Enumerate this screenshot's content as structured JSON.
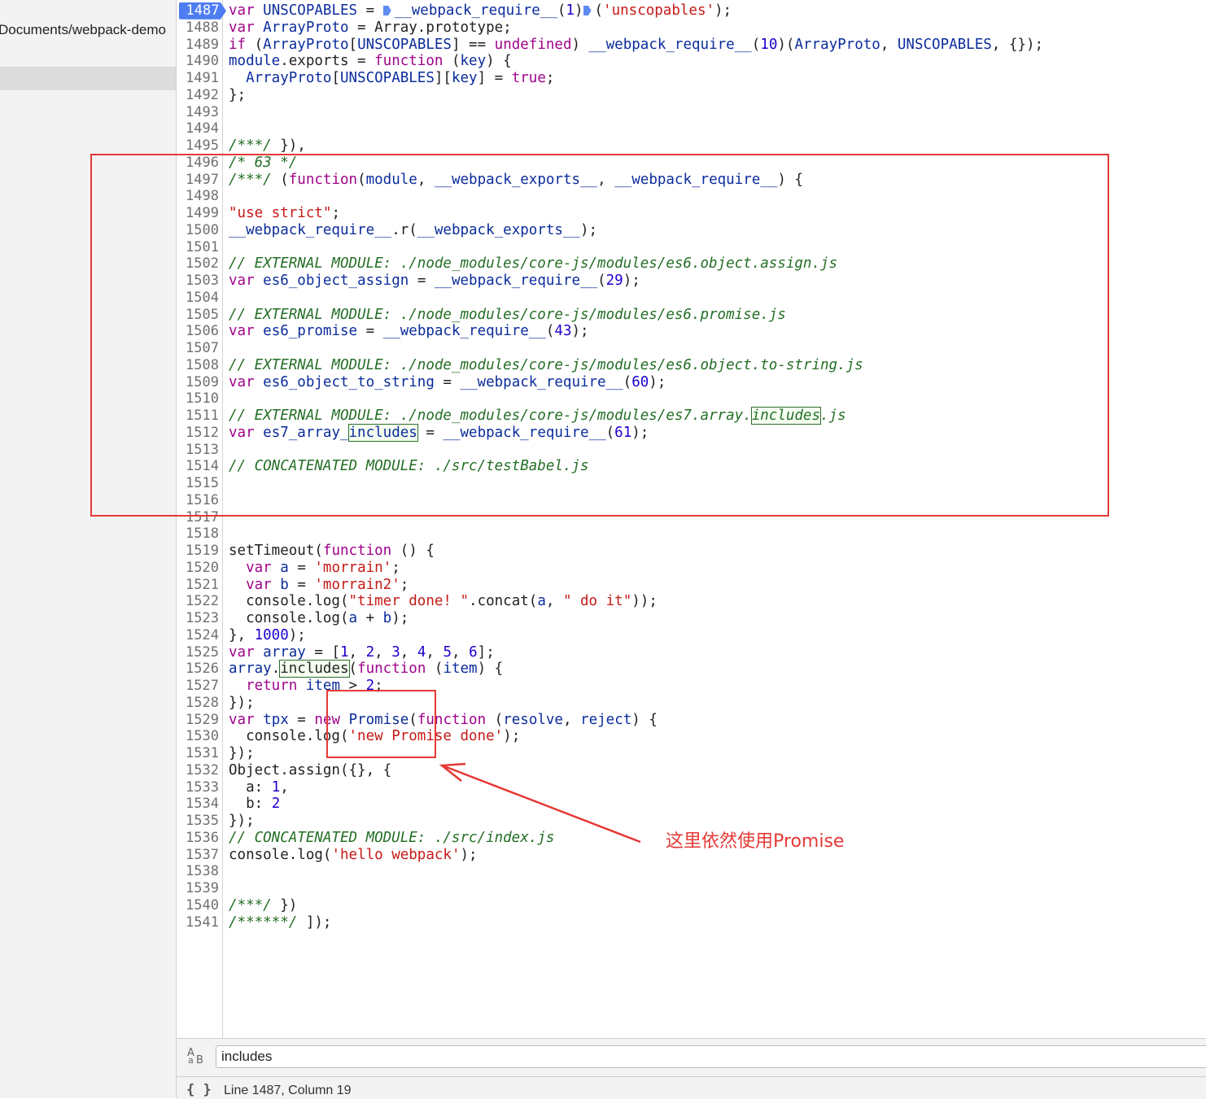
{
  "navigator": {
    "path_text": "Documents/webpack-demo"
  },
  "editor": {
    "active_line": "1487",
    "lines": [
      {
        "n": "1487",
        "segs": [
          {
            "t": "var ",
            "c": "kw2"
          },
          {
            "t": "UNSCOPABLES",
            "c": "var"
          },
          {
            "t": " = "
          },
          {
            "t": "",
            "c": "bp"
          },
          {
            "t": "__webpack_require__",
            "c": "var"
          },
          {
            "t": "("
          },
          {
            "t": "1",
            "c": "num"
          },
          {
            "t": ")"
          },
          {
            "t": "",
            "c": "bp"
          },
          {
            "t": "("
          },
          {
            "t": "'unscopables'",
            "c": "str"
          },
          {
            "t": ");"
          }
        ]
      },
      {
        "n": "1488",
        "segs": [
          {
            "t": "var ",
            "c": "kw2"
          },
          {
            "t": "ArrayProto",
            "c": "var"
          },
          {
            "t": " = Array.prototype;"
          }
        ]
      },
      {
        "n": "1489",
        "segs": [
          {
            "t": "if ",
            "c": "kw2"
          },
          {
            "t": "("
          },
          {
            "t": "ArrayProto",
            "c": "var"
          },
          {
            "t": "["
          },
          {
            "t": "UNSCOPABLES",
            "c": "var"
          },
          {
            "t": "] == "
          },
          {
            "t": "undefined",
            "c": "kw2"
          },
          {
            "t": ") "
          },
          {
            "t": "__webpack_require__",
            "c": "var"
          },
          {
            "t": "("
          },
          {
            "t": "10",
            "c": "num"
          },
          {
            "t": ")("
          },
          {
            "t": "ArrayProto",
            "c": "var"
          },
          {
            "t": ", "
          },
          {
            "t": "UNSCOPABLES",
            "c": "var"
          },
          {
            "t": ", {});"
          }
        ]
      },
      {
        "n": "1490",
        "segs": [
          {
            "t": "module",
            "c": "var"
          },
          {
            "t": ".exports = "
          },
          {
            "t": "function",
            "c": "kw2"
          },
          {
            "t": " ("
          },
          {
            "t": "key",
            "c": "var"
          },
          {
            "t": ") {"
          }
        ]
      },
      {
        "n": "1491",
        "segs": [
          {
            "t": "  "
          },
          {
            "t": "ArrayProto",
            "c": "var"
          },
          {
            "t": "["
          },
          {
            "t": "UNSCOPABLES",
            "c": "var"
          },
          {
            "t": "]["
          },
          {
            "t": "key",
            "c": "var"
          },
          {
            "t": "] = "
          },
          {
            "t": "true",
            "c": "kw2"
          },
          {
            "t": ";"
          }
        ]
      },
      {
        "n": "1492",
        "segs": [
          {
            "t": "};"
          }
        ]
      },
      {
        "n": "1493",
        "segs": []
      },
      {
        "n": "1494",
        "segs": []
      },
      {
        "n": "1495",
        "segs": [
          {
            "t": "/***/",
            "c": "cm"
          },
          {
            "t": " }),"
          }
        ]
      },
      {
        "n": "1496",
        "segs": [
          {
            "t": "/* 63 */",
            "c": "cm"
          }
        ]
      },
      {
        "n": "1497",
        "segs": [
          {
            "t": "/***/",
            "c": "cm"
          },
          {
            "t": " ("
          },
          {
            "t": "function",
            "c": "kw2"
          },
          {
            "t": "("
          },
          {
            "t": "module",
            "c": "var"
          },
          {
            "t": ", "
          },
          {
            "t": "__webpack_exports__",
            "c": "var"
          },
          {
            "t": ", "
          },
          {
            "t": "__webpack_require__",
            "c": "var"
          },
          {
            "t": ") {"
          }
        ]
      },
      {
        "n": "1498",
        "segs": []
      },
      {
        "n": "1499",
        "segs": [
          {
            "t": "\"use strict\"",
            "c": "str"
          },
          {
            "t": ";"
          }
        ]
      },
      {
        "n": "1500",
        "segs": [
          {
            "t": "__webpack_require__",
            "c": "var"
          },
          {
            "t": ".r("
          },
          {
            "t": "__webpack_exports__",
            "c": "var"
          },
          {
            "t": ");"
          }
        ]
      },
      {
        "n": "1501",
        "segs": []
      },
      {
        "n": "1502",
        "segs": [
          {
            "t": "// EXTERNAL MODULE: ./node_modules/core-js/modules/es6.object.assign.js",
            "c": "cm"
          }
        ]
      },
      {
        "n": "1503",
        "segs": [
          {
            "t": "var ",
            "c": "kw2"
          },
          {
            "t": "es6_object_assign",
            "c": "var"
          },
          {
            "t": " = "
          },
          {
            "t": "__webpack_require__",
            "c": "var"
          },
          {
            "t": "("
          },
          {
            "t": "29",
            "c": "num"
          },
          {
            "t": ");"
          }
        ]
      },
      {
        "n": "1504",
        "segs": []
      },
      {
        "n": "1505",
        "segs": [
          {
            "t": "// EXTERNAL MODULE: ./node_modules/core-js/modules/es6.promise.js",
            "c": "cm"
          }
        ]
      },
      {
        "n": "1506",
        "segs": [
          {
            "t": "var ",
            "c": "kw2"
          },
          {
            "t": "es6_promise",
            "c": "var"
          },
          {
            "t": " = "
          },
          {
            "t": "__webpack_require__",
            "c": "var"
          },
          {
            "t": "("
          },
          {
            "t": "43",
            "c": "num"
          },
          {
            "t": ");"
          }
        ]
      },
      {
        "n": "1507",
        "segs": []
      },
      {
        "n": "1508",
        "segs": [
          {
            "t": "// EXTERNAL MODULE: ./node_modules/core-js/modules/es6.object.to-string.js",
            "c": "cm"
          }
        ]
      },
      {
        "n": "1509",
        "segs": [
          {
            "t": "var ",
            "c": "kw2"
          },
          {
            "t": "es6_object_to_string",
            "c": "var"
          },
          {
            "t": " = "
          },
          {
            "t": "__webpack_require__",
            "c": "var"
          },
          {
            "t": "("
          },
          {
            "t": "60",
            "c": "num"
          },
          {
            "t": ");"
          }
        ]
      },
      {
        "n": "1510",
        "segs": []
      },
      {
        "n": "1511",
        "segs": [
          {
            "t": "// EXTERNAL MODULE: ./node_modules/core-js/modules/es7.array.",
            "c": "cm"
          },
          {
            "t": "includes",
            "c": "cm mark"
          },
          {
            "t": ".js",
            "c": "cm"
          }
        ]
      },
      {
        "n": "1512",
        "segs": [
          {
            "t": "var ",
            "c": "kw2"
          },
          {
            "t": "es7_array_",
            "c": "var"
          },
          {
            "t": "includes",
            "c": "var mark"
          },
          {
            "t": " = "
          },
          {
            "t": "__webpack_require__",
            "c": "var"
          },
          {
            "t": "("
          },
          {
            "t": "61",
            "c": "num"
          },
          {
            "t": ");"
          }
        ]
      },
      {
        "n": "1513",
        "segs": []
      },
      {
        "n": "1514",
        "segs": [
          {
            "t": "// CONCATENATED MODULE: ./src/testBabel.js",
            "c": "cm"
          }
        ]
      },
      {
        "n": "1515",
        "segs": []
      },
      {
        "n": "1516",
        "segs": []
      },
      {
        "n": "1517",
        "segs": []
      },
      {
        "n": "1518",
        "segs": []
      },
      {
        "n": "1519",
        "segs": [
          {
            "t": "setTimeout("
          },
          {
            "t": "function",
            "c": "kw2"
          },
          {
            "t": " () {"
          }
        ]
      },
      {
        "n": "1520",
        "segs": [
          {
            "t": "  "
          },
          {
            "t": "var ",
            "c": "kw2"
          },
          {
            "t": "a",
            "c": "var"
          },
          {
            "t": " = "
          },
          {
            "t": "'morrain'",
            "c": "str"
          },
          {
            "t": ";"
          }
        ]
      },
      {
        "n": "1521",
        "segs": [
          {
            "t": "  "
          },
          {
            "t": "var ",
            "c": "kw2"
          },
          {
            "t": "b",
            "c": "var"
          },
          {
            "t": " = "
          },
          {
            "t": "'morrain2'",
            "c": "str"
          },
          {
            "t": ";"
          }
        ]
      },
      {
        "n": "1522",
        "segs": [
          {
            "t": "  console.log("
          },
          {
            "t": "\"timer done! \"",
            "c": "str"
          },
          {
            "t": ".concat("
          },
          {
            "t": "a",
            "c": "var"
          },
          {
            "t": ", "
          },
          {
            "t": "\" do it\"",
            "c": "str"
          },
          {
            "t": "));"
          }
        ]
      },
      {
        "n": "1523",
        "segs": [
          {
            "t": "  console.log("
          },
          {
            "t": "a",
            "c": "var"
          },
          {
            "t": " + "
          },
          {
            "t": "b",
            "c": "var"
          },
          {
            "t": ");"
          }
        ]
      },
      {
        "n": "1524",
        "segs": [
          {
            "t": "}, "
          },
          {
            "t": "1000",
            "c": "num"
          },
          {
            "t": ");"
          }
        ]
      },
      {
        "n": "1525",
        "segs": [
          {
            "t": "var ",
            "c": "kw2"
          },
          {
            "t": "array",
            "c": "var"
          },
          {
            "t": " = ["
          },
          {
            "t": "1",
            "c": "num"
          },
          {
            "t": ", "
          },
          {
            "t": "2",
            "c": "num"
          },
          {
            "t": ", "
          },
          {
            "t": "3",
            "c": "num"
          },
          {
            "t": ", "
          },
          {
            "t": "4",
            "c": "num"
          },
          {
            "t": ", "
          },
          {
            "t": "5",
            "c": "num"
          },
          {
            "t": ", "
          },
          {
            "t": "6",
            "c": "num"
          },
          {
            "t": "];"
          }
        ]
      },
      {
        "n": "1526",
        "segs": [
          {
            "t": "array",
            "c": "var"
          },
          {
            "t": "."
          },
          {
            "t": "includes",
            "c": "mark"
          },
          {
            "t": "("
          },
          {
            "t": "function",
            "c": "kw2"
          },
          {
            "t": " ("
          },
          {
            "t": "item",
            "c": "var"
          },
          {
            "t": ") {"
          }
        ]
      },
      {
        "n": "1527",
        "segs": [
          {
            "t": "  "
          },
          {
            "t": "return ",
            "c": "kw2"
          },
          {
            "t": "item",
            "c": "var"
          },
          {
            "t": " > "
          },
          {
            "t": "2",
            "c": "num"
          },
          {
            "t": ";"
          }
        ]
      },
      {
        "n": "1528",
        "segs": [
          {
            "t": "});"
          }
        ]
      },
      {
        "n": "1529",
        "segs": [
          {
            "t": "var ",
            "c": "kw2"
          },
          {
            "t": "tpx",
            "c": "var"
          },
          {
            "t": " = "
          },
          {
            "t": "new ",
            "c": "kw2"
          },
          {
            "t": "Promise",
            "c": "var"
          },
          {
            "t": "("
          },
          {
            "t": "function",
            "c": "kw2"
          },
          {
            "t": " ("
          },
          {
            "t": "resolve",
            "c": "var"
          },
          {
            "t": ", "
          },
          {
            "t": "reject",
            "c": "var"
          },
          {
            "t": ") {"
          }
        ]
      },
      {
        "n": "1530",
        "segs": [
          {
            "t": "  console.log("
          },
          {
            "t": "'new Promise done'",
            "c": "str"
          },
          {
            "t": ");"
          }
        ]
      },
      {
        "n": "1531",
        "segs": [
          {
            "t": "});"
          }
        ]
      },
      {
        "n": "1532",
        "segs": [
          {
            "t": "Object.assign({}, {"
          }
        ]
      },
      {
        "n": "1533",
        "segs": [
          {
            "t": "  a: "
          },
          {
            "t": "1",
            "c": "num"
          },
          {
            "t": ","
          }
        ]
      },
      {
        "n": "1534",
        "segs": [
          {
            "t": "  b: "
          },
          {
            "t": "2",
            "c": "num"
          }
        ]
      },
      {
        "n": "1535",
        "segs": [
          {
            "t": "});"
          }
        ]
      },
      {
        "n": "1536",
        "segs": [
          {
            "t": "// CONCATENATED MODULE: ./src/index.js",
            "c": "cm"
          }
        ]
      },
      {
        "n": "1537",
        "segs": [
          {
            "t": "console.log("
          },
          {
            "t": "'hello webpack'",
            "c": "str"
          },
          {
            "t": ");"
          }
        ]
      },
      {
        "n": "1538",
        "segs": []
      },
      {
        "n": "1539",
        "segs": []
      },
      {
        "n": "1540",
        "segs": [
          {
            "t": "/***/",
            "c": "cm"
          },
          {
            "t": " })"
          }
        ]
      },
      {
        "n": "1541",
        "segs": [
          {
            "t": "/******/",
            "c": "cm"
          },
          {
            "t": " ]);"
          }
        ]
      }
    ]
  },
  "annotation": {
    "text": "这里依然使用Promise",
    "color": "#e53935"
  },
  "search": {
    "value": "includes",
    "case_icon": "match-case-icon"
  },
  "status": {
    "cursor_text": "Line 1487, Column 19",
    "format_icon_glyph": "{ }"
  }
}
